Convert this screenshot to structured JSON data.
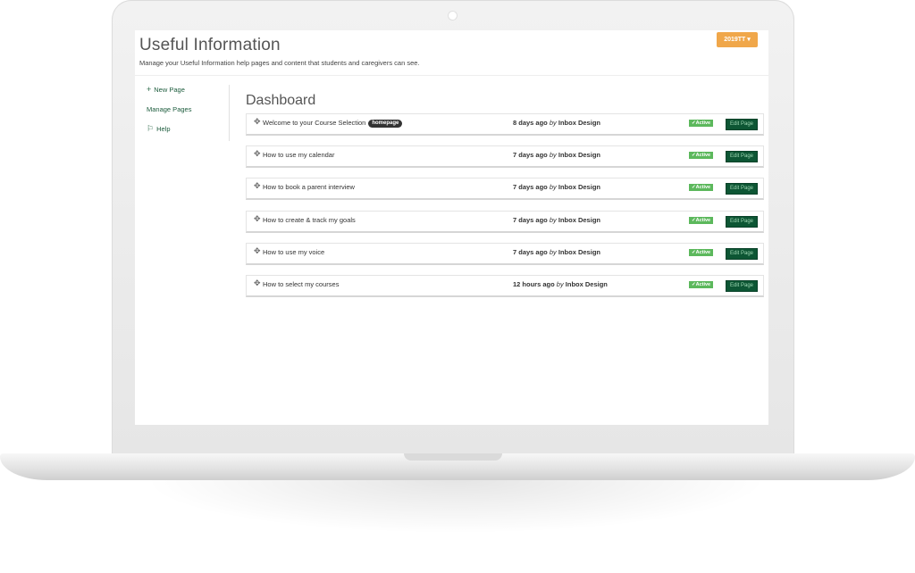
{
  "app": {
    "title": "Useful Information",
    "subtitle": "Manage your Useful Information help pages and content that students and caregivers can see.",
    "term_button": "2019TT ▾"
  },
  "sidebar": {
    "items": [
      {
        "label": "New Page",
        "icon": "+"
      },
      {
        "label": "Manage Pages",
        "icon": ""
      },
      {
        "label": "Help",
        "icon": "⚐"
      }
    ]
  },
  "main": {
    "title": "Dashboard",
    "rows": [
      {
        "title": "Welcome to your Course Selection",
        "badge": "homepage",
        "time": "8 days ago",
        "by": "by",
        "author": "Inbox Design",
        "status": "Active",
        "edit": "Edit Page"
      },
      {
        "title": "How to use my calendar",
        "badge": "",
        "time": "7 days ago",
        "by": "by",
        "author": "Inbox Design",
        "status": "Active",
        "edit": "Edit Page"
      },
      {
        "title": "How to book a parent interview",
        "badge": "",
        "time": "7 days ago",
        "by": "by",
        "author": "Inbox Design",
        "status": "Active",
        "edit": "Edit Page"
      },
      {
        "title": "How to create & track my goals",
        "badge": "",
        "time": "7 days ago",
        "by": "by",
        "author": "Inbox Design",
        "status": "Active",
        "edit": "Edit Page"
      },
      {
        "title": "How to use my voice",
        "badge": "",
        "time": "7 days ago",
        "by": "by",
        "author": "Inbox Design",
        "status": "Active",
        "edit": "Edit Page"
      },
      {
        "title": "How to select my courses",
        "badge": "",
        "time": "12 hours ago",
        "by": "by",
        "author": "Inbox Design",
        "status": "Active",
        "edit": "Edit Page"
      }
    ]
  },
  "colors": {
    "accent_orange": "#f0a74a",
    "brand_green": "#0d5634",
    "status_green": "#5cb85c"
  },
  "icons": {
    "drag": "drag-handle-icon",
    "add": "plus-icon",
    "help": "flag-icon",
    "check": "check-icon"
  }
}
